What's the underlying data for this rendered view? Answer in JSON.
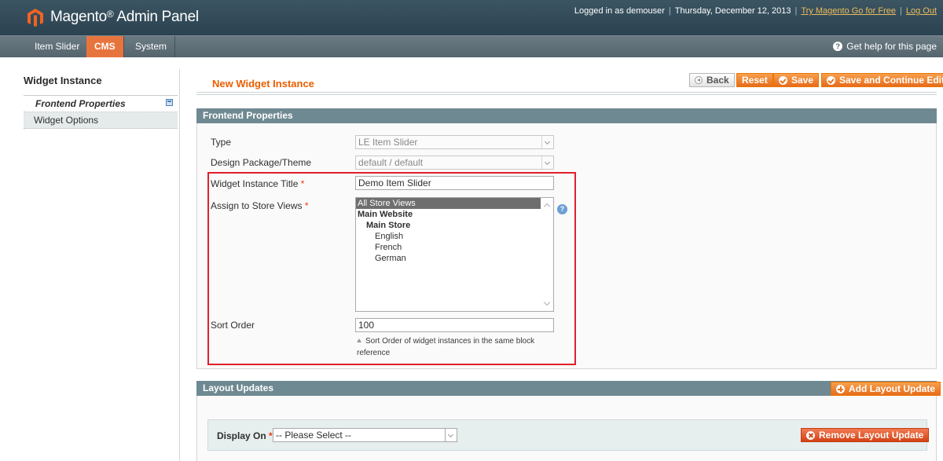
{
  "header": {
    "logo_text": "Magento",
    "logo_suffix": "Admin Panel",
    "logged_in": "Logged in as demouser",
    "date": "Thursday, December 12, 2013",
    "try_link": "Try Magento Go for Free",
    "logout_link": "Log Out"
  },
  "nav": {
    "items": [
      "Item Slider",
      "CMS",
      "System"
    ],
    "active": "CMS",
    "help": "Get help for this page"
  },
  "sidebar": {
    "title": "Widget Instance",
    "tabs": [
      "Frontend Properties",
      "Widget Options"
    ]
  },
  "page": {
    "title": "New Widget Instance",
    "buttons": {
      "back": "Back",
      "reset": "Reset",
      "save": "Save",
      "save_continue": "Save and Continue Edit"
    }
  },
  "frontend": {
    "section_title": "Frontend Properties",
    "type_label": "Type",
    "type_value": "LE Item Slider",
    "design_label": "Design Package/Theme",
    "design_value": "default / default",
    "title_label": "Widget Instance Title",
    "title_value": "Demo Item Slider",
    "store_label": "Assign to Store Views",
    "store_options": [
      "All Store Views",
      "Main Website",
      "Main Store",
      "English",
      "French",
      "German"
    ],
    "store_selected": "All Store Views",
    "sort_label": "Sort Order",
    "sort_value": "100",
    "sort_hint": "Sort Order of widget instances in the same block reference",
    "required_mark": "*"
  },
  "layout": {
    "section_title": "Layout Updates",
    "add_button": "Add Layout Update",
    "display_on_label": "Display On",
    "display_on_value": "-- Please Select --",
    "remove_button": "Remove Layout Update"
  },
  "colors": {
    "header_bg": "#334b59",
    "nav_bg": "#5f6f78",
    "accent": "#eb5e00",
    "button": "#e8741f",
    "section_head": "#6f8992",
    "highlight_box": "#e0202d"
  }
}
